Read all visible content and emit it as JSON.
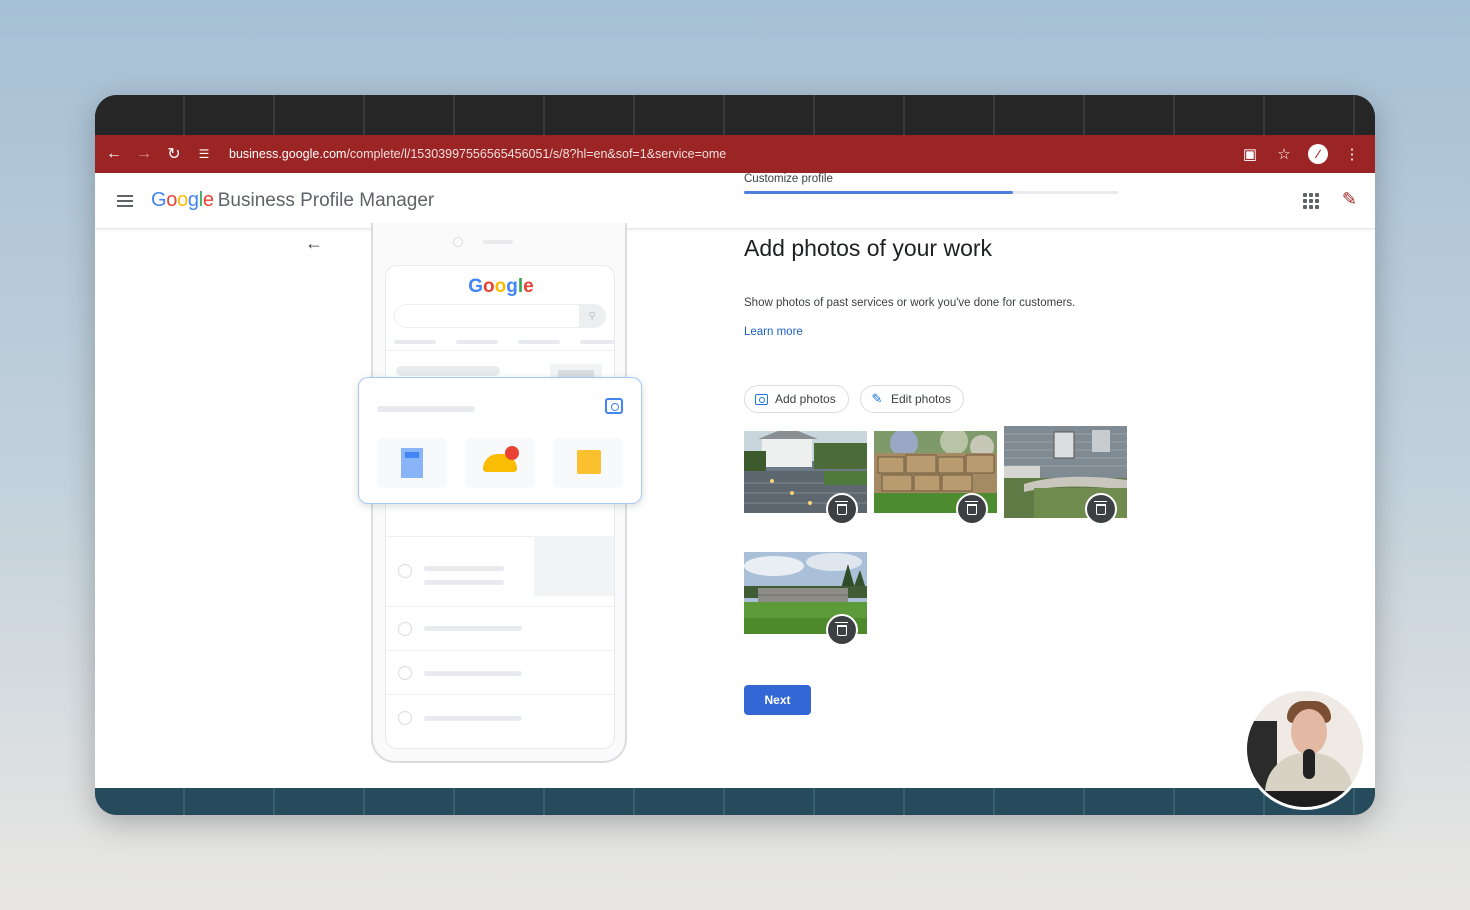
{
  "browser": {
    "url_host": "business.google.com",
    "url_path": "/complete/l/15303997556565456051/s/8?hl=en&sof=1&service=ome"
  },
  "app": {
    "brand_google": "Google",
    "brand_rest": "Business Profile Manager"
  },
  "preview": {
    "logo": "Google"
  },
  "form": {
    "step_label": "Customize profile",
    "progress": 0.72,
    "heading": "Add photos of your work",
    "description": "Show photos of past services or work you've done for customers.",
    "learn_more": "Learn more",
    "add_photos_label": "Add photos",
    "edit_photos_label": "Edit photos",
    "next_label": "Next"
  },
  "photos": [
    {
      "subject": "house-with-stone-steps"
    },
    {
      "subject": "stone-retaining-wall-plants"
    },
    {
      "subject": "house-corner-garden"
    },
    {
      "subject": "lawn-with-stone-wall"
    }
  ],
  "colors": {
    "address_bar": "#9b2424",
    "primary_button": "#3367d6",
    "progress": "#4f7fde",
    "link": "#1a5fc2"
  }
}
